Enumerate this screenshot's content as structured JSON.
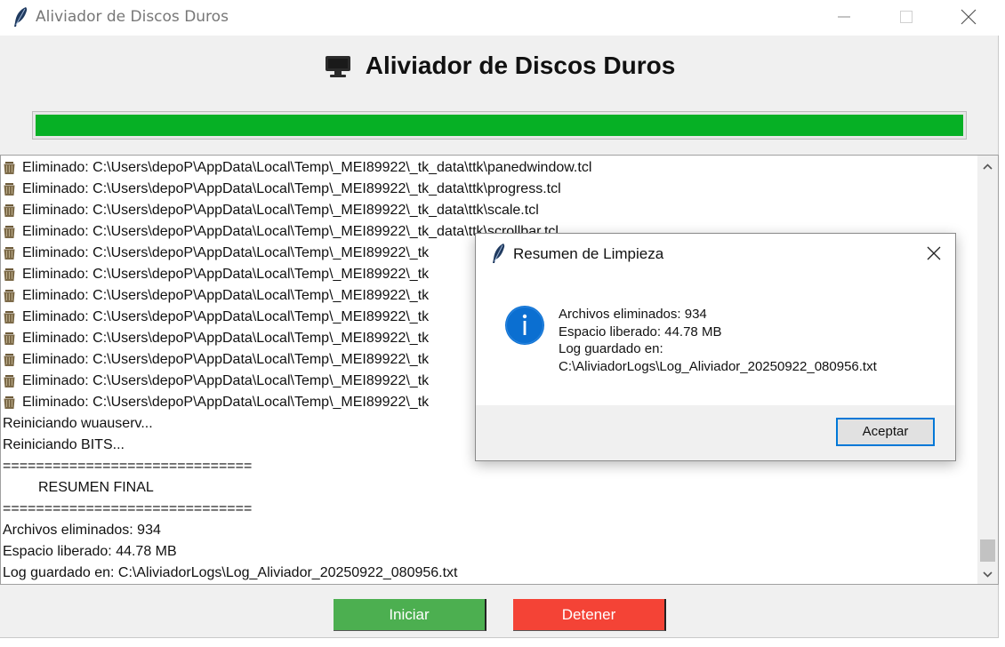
{
  "window": {
    "title": "Aliviador de Discos Duros",
    "icons": {
      "app": "feather-icon",
      "minimize": "minimize-icon",
      "maximize": "maximize-icon",
      "close": "close-icon"
    }
  },
  "header": {
    "icon": "monitor-icon",
    "title": "Aliviador de Discos Duros"
  },
  "progress": {
    "value_percent": 100,
    "color": "#06b025"
  },
  "log": {
    "lines": [
      {
        "icon": "trash-icon",
        "text": "Eliminado: C:\\Users\\depoP\\AppData\\Local\\Temp\\_MEI89922\\_tk_data\\ttk\\panedwindow.tcl"
      },
      {
        "icon": "trash-icon",
        "text": "Eliminado: C:\\Users\\depoP\\AppData\\Local\\Temp\\_MEI89922\\_tk_data\\ttk\\progress.tcl"
      },
      {
        "icon": "trash-icon",
        "text": "Eliminado: C:\\Users\\depoP\\AppData\\Local\\Temp\\_MEI89922\\_tk_data\\ttk\\scale.tcl"
      },
      {
        "icon": "trash-icon",
        "text": "Eliminado: C:\\Users\\depoP\\AppData\\Local\\Temp\\_MEI89922\\_tk_data\\ttk\\scrollbar.tcl"
      },
      {
        "icon": "trash-icon",
        "text": "Eliminado: C:\\Users\\depoP\\AppData\\Local\\Temp\\_MEI89922\\_tk"
      },
      {
        "icon": "trash-icon",
        "text": "Eliminado: C:\\Users\\depoP\\AppData\\Local\\Temp\\_MEI89922\\_tk"
      },
      {
        "icon": "trash-icon",
        "text": "Eliminado: C:\\Users\\depoP\\AppData\\Local\\Temp\\_MEI89922\\_tk"
      },
      {
        "icon": "trash-icon",
        "text": "Eliminado: C:\\Users\\depoP\\AppData\\Local\\Temp\\_MEI89922\\_tk"
      },
      {
        "icon": "trash-icon",
        "text": "Eliminado: C:\\Users\\depoP\\AppData\\Local\\Temp\\_MEI89922\\_tk"
      },
      {
        "icon": "trash-icon",
        "text": "Eliminado: C:\\Users\\depoP\\AppData\\Local\\Temp\\_MEI89922\\_tk"
      },
      {
        "icon": "trash-icon",
        "text": "Eliminado: C:\\Users\\depoP\\AppData\\Local\\Temp\\_MEI89922\\_tk"
      },
      {
        "icon": "trash-icon",
        "text": "Eliminado: C:\\Users\\depoP\\AppData\\Local\\Temp\\_MEI89922\\_tk"
      },
      {
        "text": "Reiniciando wuauserv..."
      },
      {
        "text": "Reiniciando BITS..."
      },
      {
        "text": "=============================="
      },
      {
        "text": "RESUMEN FINAL",
        "indent": true
      },
      {
        "text": "=============================="
      },
      {
        "text": "Archivos eliminados: 934"
      },
      {
        "text": "Espacio liberado: 44.78 MB"
      },
      {
        "text": "Log guardado en: C:\\AliviadorLogs\\Log_Aliviador_20250922_080956.txt"
      }
    ]
  },
  "buttons": {
    "start": {
      "label": "Iniciar",
      "color": "#4caf50"
    },
    "stop": {
      "label": "Detener",
      "color": "#f44336"
    }
  },
  "dialog": {
    "title": "Resumen de Limpieza",
    "icon": "info-icon",
    "lines": [
      "Archivos eliminados: 934",
      "Espacio liberado: 44.78 MB",
      "Log guardado en:",
      "C:\\AliviadorLogs\\Log_Aliviador_20250922_080956.txt"
    ],
    "ok_label": "Aceptar"
  }
}
